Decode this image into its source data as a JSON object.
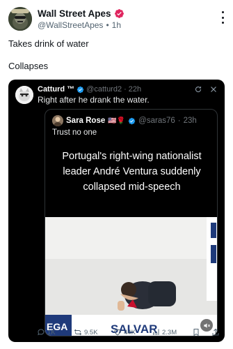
{
  "author": {
    "name": "Wall Street Apes",
    "handle": "@WallStreetApes",
    "separator": "•",
    "time": "1h"
  },
  "tweet": {
    "line1": "Takes drink of water",
    "line2": "Collapses"
  },
  "quoted": {
    "name": "Catturd ™",
    "handle": "@catturd2",
    "time": "22h",
    "text": "Right after he drank the water."
  },
  "inner_quote": {
    "name": "Sara Rose",
    "flags": "🇺🇸🌹",
    "handle": "@saras76",
    "time": "23h",
    "text": "Trust no one"
  },
  "video": {
    "headline_line1": "Portugal's right-wing nationalist",
    "headline_line2": "leader André Ventura suddenly",
    "headline_line3": "collapsed mid-speech",
    "podium_left": "EGA",
    "podium_center": "SALVAR"
  },
  "stats": {
    "replies": "1K",
    "reposts": "9.5K",
    "likes": "44K",
    "views": "2.3M"
  },
  "colors": {
    "verified_pink": "#e0245e",
    "verified_blue": "#1d9bf0",
    "text_primary": "#0f1419",
    "text_secondary": "#536471"
  }
}
